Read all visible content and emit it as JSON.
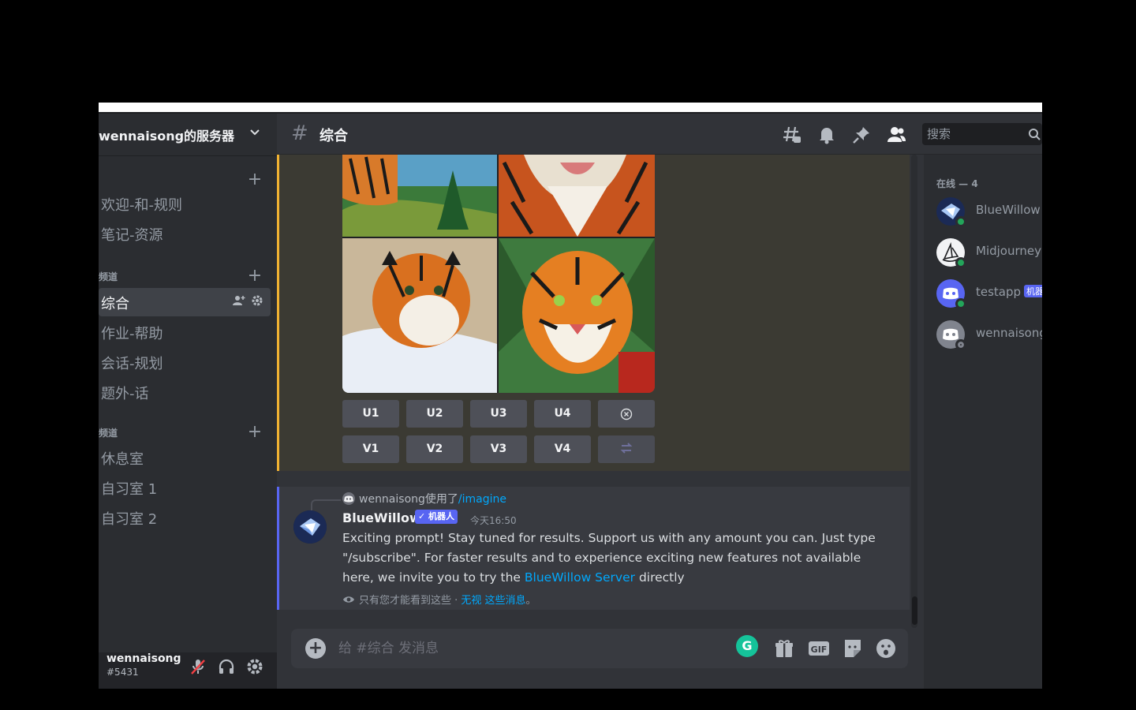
{
  "server": {
    "name": "wennaisong的服务器"
  },
  "categories": [
    {
      "label": ""
    },
    {
      "label": "频道"
    },
    {
      "label": "频道"
    }
  ],
  "channels": {
    "group1": [
      "欢迎-和-规则",
      "笔记-资源"
    ],
    "group2": [
      "综合",
      "作业-帮助",
      "会话-规划",
      "题外-话"
    ],
    "group3": [
      "休息室",
      "自习室 1",
      "自习室 2"
    ]
  },
  "user": {
    "name": "wennaisong",
    "discriminator": "#5431"
  },
  "header": {
    "channel": "综合",
    "search_placeholder": "搜索"
  },
  "midjourney_buttons": {
    "upscale": [
      "U1",
      "U2",
      "U3",
      "U4"
    ],
    "variation": [
      "V1",
      "V2",
      "V3",
      "V4"
    ]
  },
  "message": {
    "reply_user": "wennaisong使用了",
    "reply_command": "/imagine",
    "author": "BlueWillow",
    "bot_tag": "✓ 机器人",
    "time": "今天16:50",
    "body_before_link": "Exciting prompt! Stay tuned for results. Support us with any amount you can. Just type \"/subscribe\". For faster results and to experience exciting new features not available here, we invite you to try the ",
    "link": "BlueWillow Server",
    "body_after_link": " directly",
    "ephemeral_text": "只有您才能看到这些 · ",
    "ephemeral_dismiss": "无视 这些消息",
    "ephemeral_end": "。"
  },
  "composer": {
    "placeholder": "给 #综合 发消息",
    "gif_label": "GIF"
  },
  "members": {
    "heading": "在线 — 4",
    "list": [
      {
        "name": "BlueWillow",
        "badge": "",
        "status_color": "#23a55a",
        "avatar": "bluewillow"
      },
      {
        "name": "Midjourney",
        "badge": "",
        "status_color": "#23a55a",
        "avatar": "midjourney"
      },
      {
        "name": "testapp",
        "badge": "机器人",
        "status_color": "#23a55a",
        "avatar": "discord"
      },
      {
        "name": "wennaisong",
        "badge": "",
        "status_color": "#80848e",
        "avatar": "discord-grey"
      }
    ]
  },
  "colors": {
    "accent": "#5865f2",
    "link": "#00a8fc",
    "highlight_bar": "#f0b232",
    "online": "#23a55a"
  }
}
